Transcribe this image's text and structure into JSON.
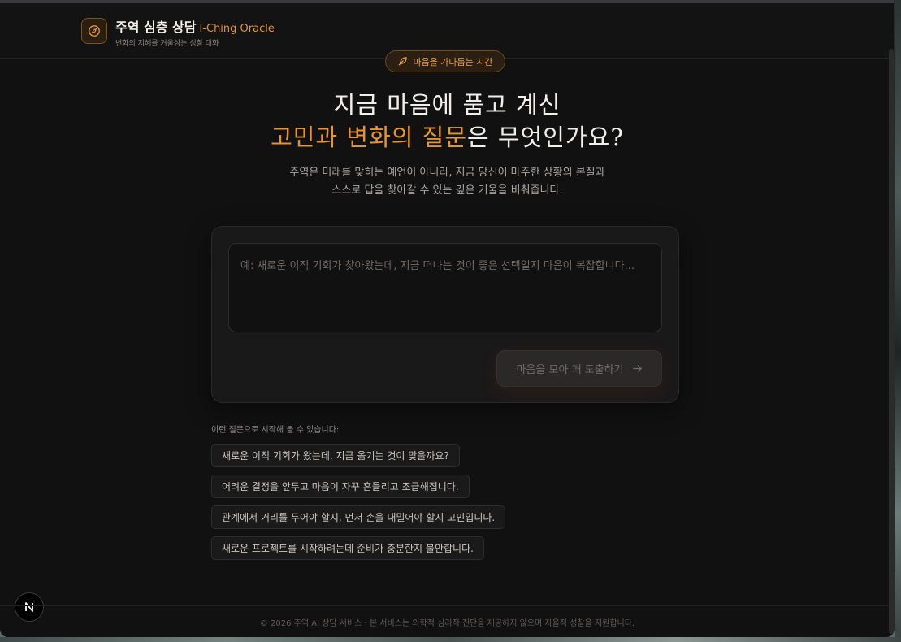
{
  "header": {
    "title": "주역 심층 상담",
    "title_en": "I-Ching Oracle",
    "tagline": "변화의 지혜를 거울삼는 성찰 대화",
    "logo_icon": "compass-icon"
  },
  "hero": {
    "pill_label": "마음을 가다듬는 시간",
    "pill_icon": "feather-icon",
    "line1": "지금 마음에 품고 계신",
    "line2_accent": "고민과 변화의 질문",
    "line2_rest": "은 무엇인가요?",
    "desc_line1": "주역은 미래를 맞히는 예언이 아니라, 지금 당신이 마주한 상황의 본질과",
    "desc_line2": "스스로 답을 찾아갈 수 있는 깊은 거울을 비춰줍니다."
  },
  "form": {
    "placeholder": "예: 새로운 이직 기회가 찾아왔는데, 지금 떠나는 것이 좋은 선택일지 마음이 복잡합니다...",
    "submit_label": "마음을 모아 괘 도출하기",
    "submit_icon": "arrow-right-icon"
  },
  "suggestions": {
    "label": "이런 질문으로 시작해 볼 수 있습니다:",
    "items": [
      "새로운 이직 기회가 왔는데, 지금 옮기는 것이 맞을까요?",
      "어려운 결정을 앞두고 마음이 자꾸 흔들리고 조급해집니다.",
      "관계에서 거리를 두어야 할지, 먼저 손을 내밀어야 할지 고민입니다.",
      "새로운 프로젝트를 시작하려는데 준비가 충분한지 불안합니다."
    ]
  },
  "footer": {
    "text": "© 2026 주역 AI 상담 서비스 · 본 서비스는 의학적 심리적 진단을 제공하지 않으며 자율적 성찰을 지원합니다."
  },
  "colors": {
    "accent": "#e7952f",
    "background": "#121112",
    "card": "#1a191a"
  }
}
